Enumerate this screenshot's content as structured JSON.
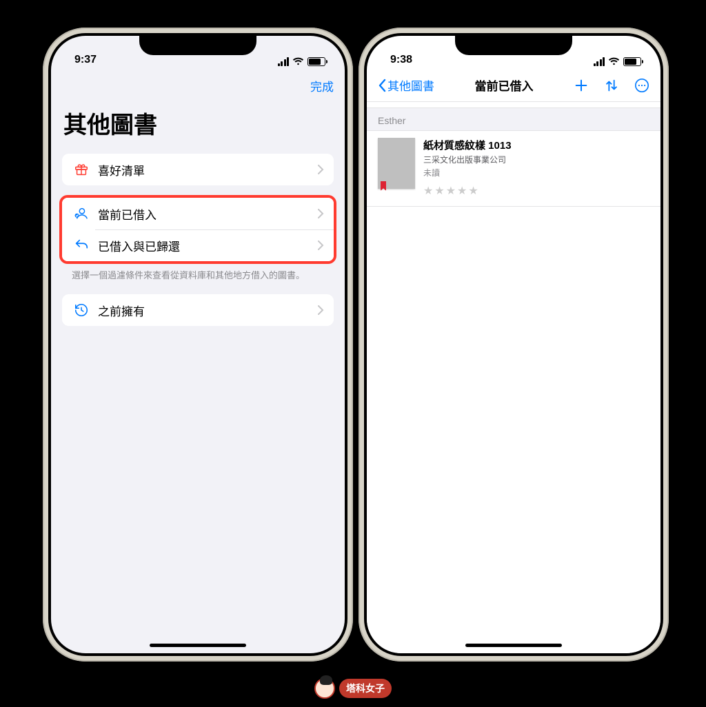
{
  "colors": {
    "accent": "#007aff",
    "highlight": "#ff3b30",
    "bg": "#f2f2f7"
  },
  "left": {
    "status": {
      "time": "9:37"
    },
    "nav": {
      "done": "完成"
    },
    "title": "其他圖書",
    "rows": {
      "wishlist": "喜好清單",
      "borrowed_now": "當前已借入",
      "borrowed_returned": "已借入與已歸還",
      "previously_owned": "之前擁有"
    },
    "footer_note": "選擇一個過濾條件來查看從資料庫和其他地方借入的圖書。"
  },
  "right": {
    "status": {
      "time": "9:38"
    },
    "nav": {
      "back": "其他圖書",
      "title": "當前已借入"
    },
    "section_header": "Esther",
    "book": {
      "title": "紙材質感紋樣 1013",
      "publisher": "三采文化出版事業公司",
      "status": "未讀",
      "stars": "★★★★★"
    }
  },
  "watermark": "塔科女子"
}
